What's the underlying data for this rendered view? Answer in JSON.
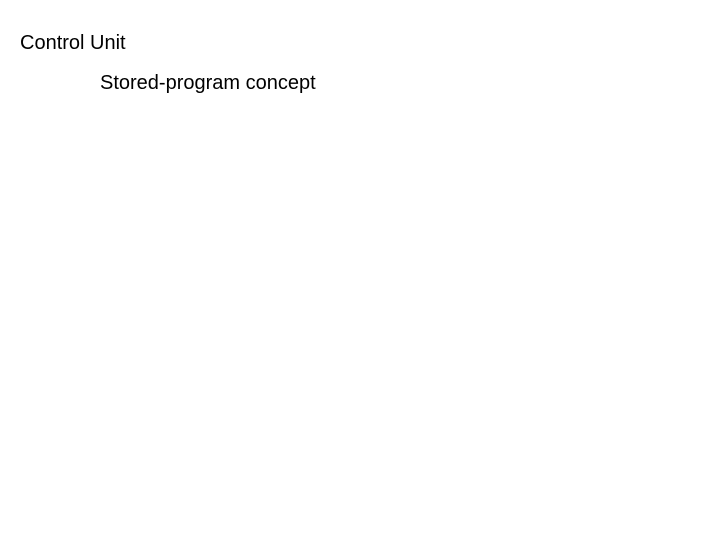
{
  "slide": {
    "heading": "Control Unit",
    "subheading": "Stored-program concept"
  }
}
